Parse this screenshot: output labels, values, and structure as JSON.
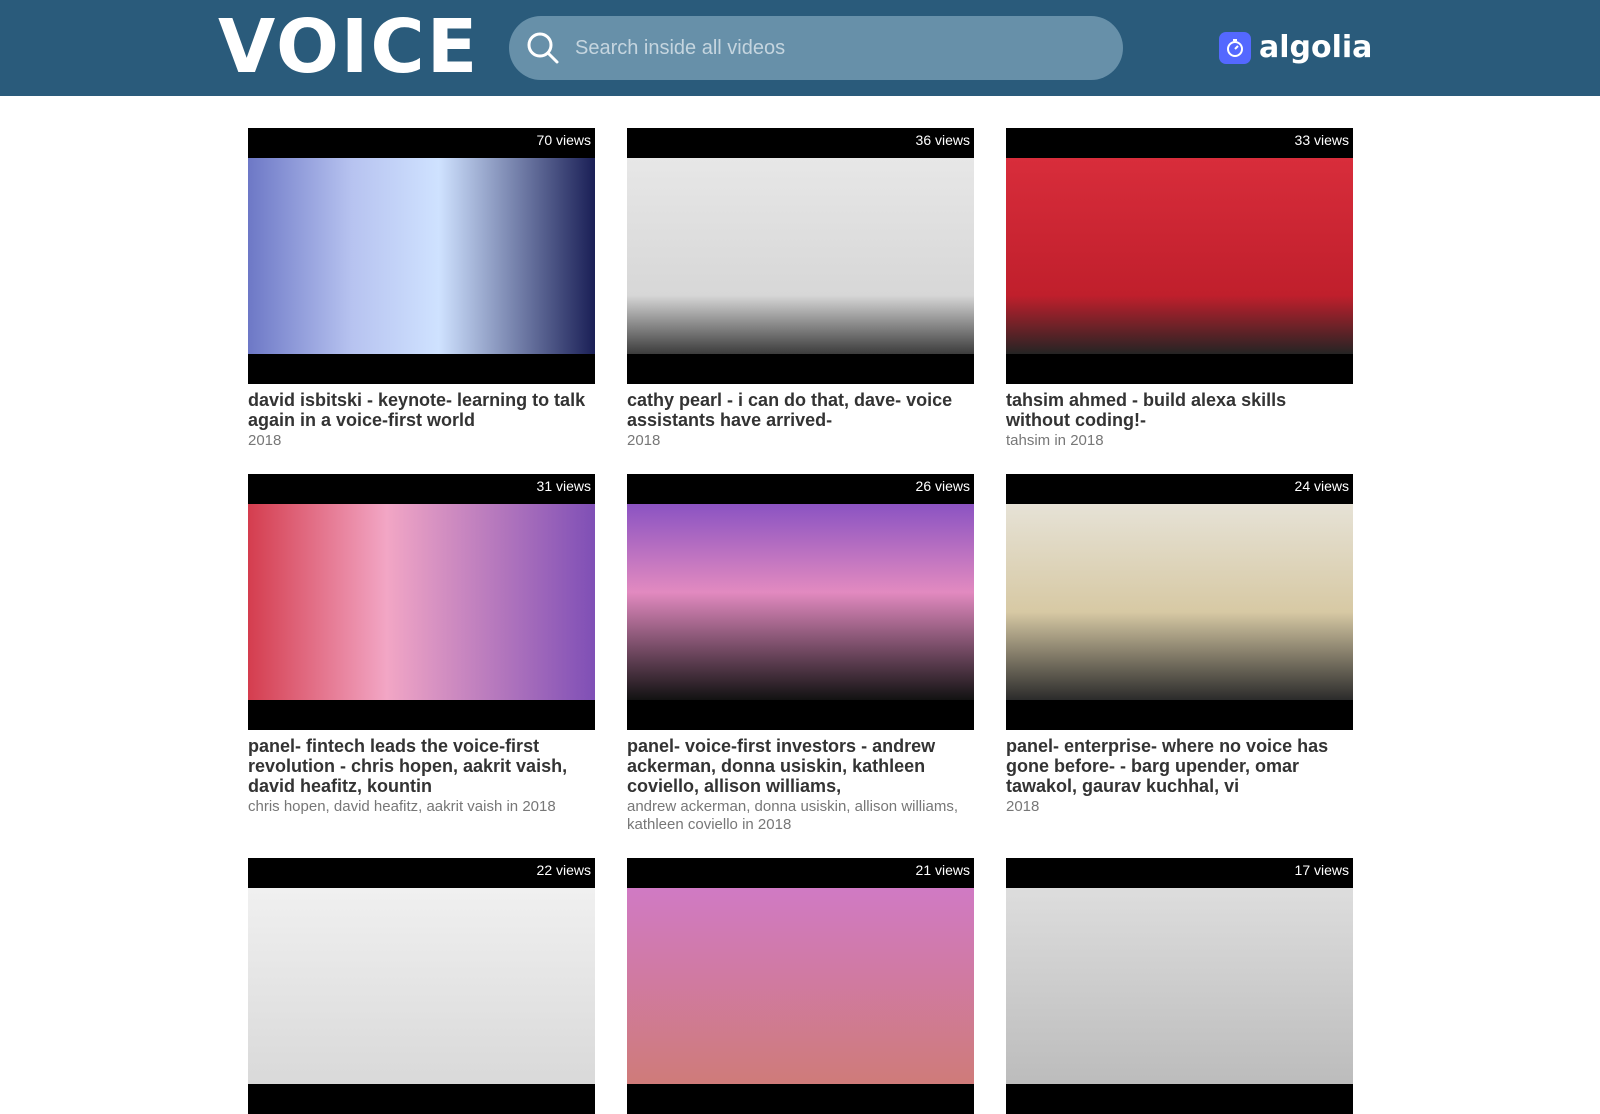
{
  "header": {
    "logo_text": "VOICE",
    "search_placeholder": "Search inside all videos",
    "algolia_text": "algolia",
    "accent_color": "#2a5b7b"
  },
  "videos": [
    {
      "views": "70 views",
      "title": "david isbitski - keynote- learning to talk again in a voice-first world",
      "subtitle": "2018"
    },
    {
      "views": "36 views",
      "title": "cathy pearl - i can do that, dave- voice assistants have arrived-",
      "subtitle": "2018"
    },
    {
      "views": "33 views",
      "title": "tahsim ahmed - build alexa skills without coding!-",
      "subtitle": "tahsim in 2018"
    },
    {
      "views": "31 views",
      "title": "panel- fintech leads the voice-first revolution - chris hopen, aakrit vaish, david heafitz, kountin",
      "subtitle": "chris hopen, david heafitz, aakrit vaish in 2018"
    },
    {
      "views": "26 views",
      "title": "panel- voice-first investors - andrew ackerman, donna usiskin, kathleen coviello, allison williams,",
      "subtitle": "andrew ackerman, donna usiskin, allison williams, kathleen coviello in 2018"
    },
    {
      "views": "24 views",
      "title": "panel- enterprise- where no voice has gone before- - barg upender, omar tawakol, gaurav kuchhal, vi",
      "subtitle": "2018"
    },
    {
      "views": "22 views",
      "title": "",
      "subtitle": ""
    },
    {
      "views": "21 views",
      "title": "",
      "subtitle": ""
    },
    {
      "views": "17 views",
      "title": "",
      "subtitle": ""
    }
  ]
}
